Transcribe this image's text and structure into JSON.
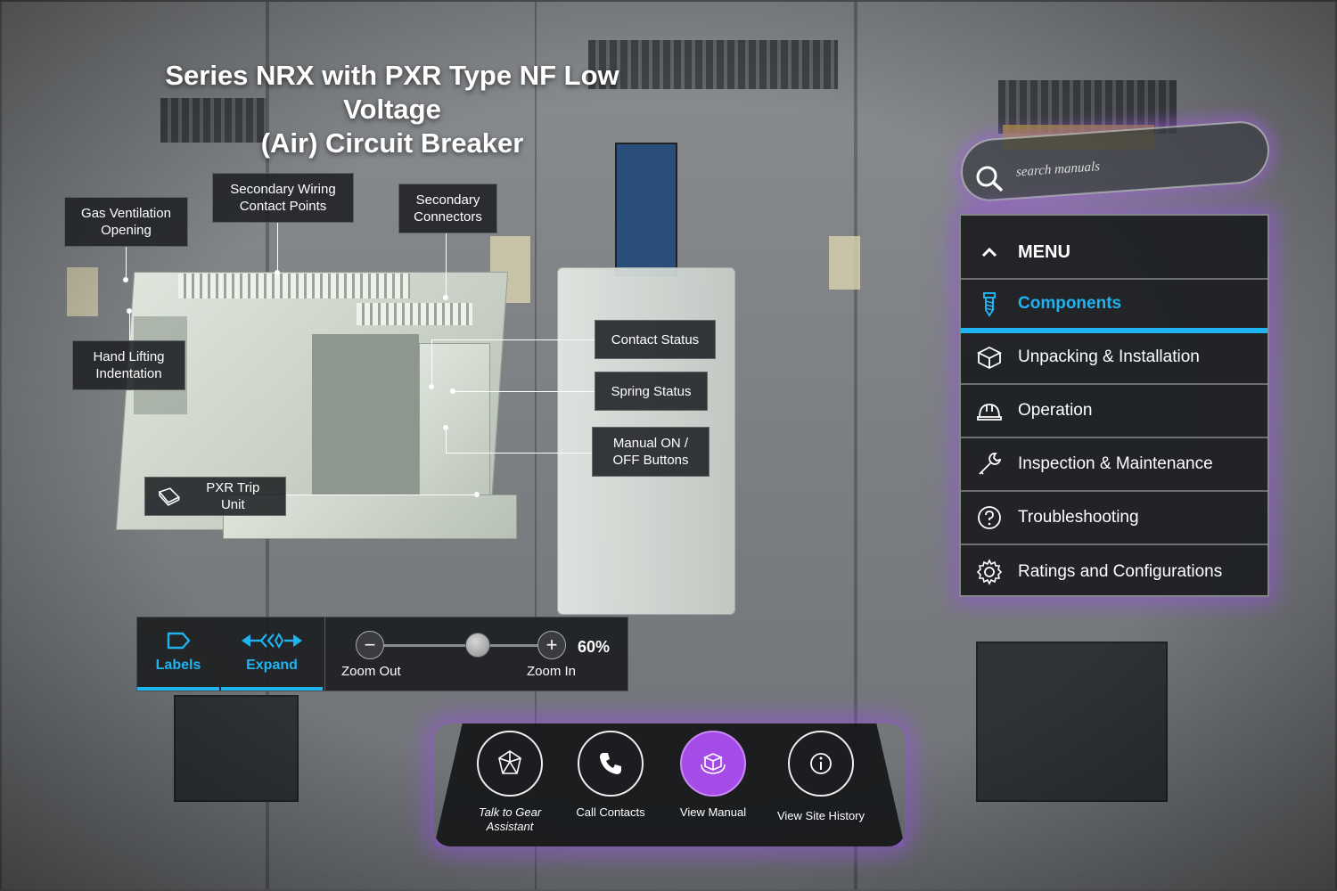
{
  "title": {
    "line1": "Series NRX with PXR Type NF Low Voltage",
    "line2": "(Air) Circuit Breaker"
  },
  "callouts": {
    "gas_ventilation": "Gas Ventilation Opening",
    "secondary_wiring": "Secondary Wiring Contact Points",
    "secondary_connectors": "Secondary Connectors",
    "hand_lifting": "Hand Lifting Indentation",
    "contact_status": "Contact Status",
    "spring_status": "Spring Status",
    "manual_buttons": "Manual ON / OFF Buttons",
    "pxr_trip_unit": "PXR Trip Unit"
  },
  "toolbar": {
    "labels_label": "Labels",
    "expand_label": "Expand",
    "zoom_out_label": "Zoom Out",
    "zoom_in_label": "Zoom In",
    "zoom_percent": "60%",
    "zoom_level": 0.6
  },
  "search": {
    "placeholder": "search manuals"
  },
  "menu": {
    "header": "MENU",
    "items": [
      {
        "label": "Components",
        "icon": "screw-icon",
        "active": true
      },
      {
        "label": "Unpacking & Installation",
        "icon": "box-icon"
      },
      {
        "label": "Operation",
        "icon": "hardhat-icon"
      },
      {
        "label": "Inspection & Maintenance",
        "icon": "wrench-icon"
      },
      {
        "label": "Troubleshooting",
        "icon": "question-icon"
      },
      {
        "label": "Ratings and Configurations",
        "icon": "gear-icon"
      }
    ]
  },
  "actions": [
    {
      "label": "Talk to Gear Assistant",
      "icon": "gem-icon"
    },
    {
      "label": "Call Contacts",
      "icon": "phone-icon"
    },
    {
      "label": "View Manual",
      "icon": "cube-icon",
      "active": true
    },
    {
      "label": "View Site History",
      "icon": "info-icon"
    }
  ],
  "colors": {
    "accent": "#1fb4ef",
    "glow": "#a54be8"
  }
}
